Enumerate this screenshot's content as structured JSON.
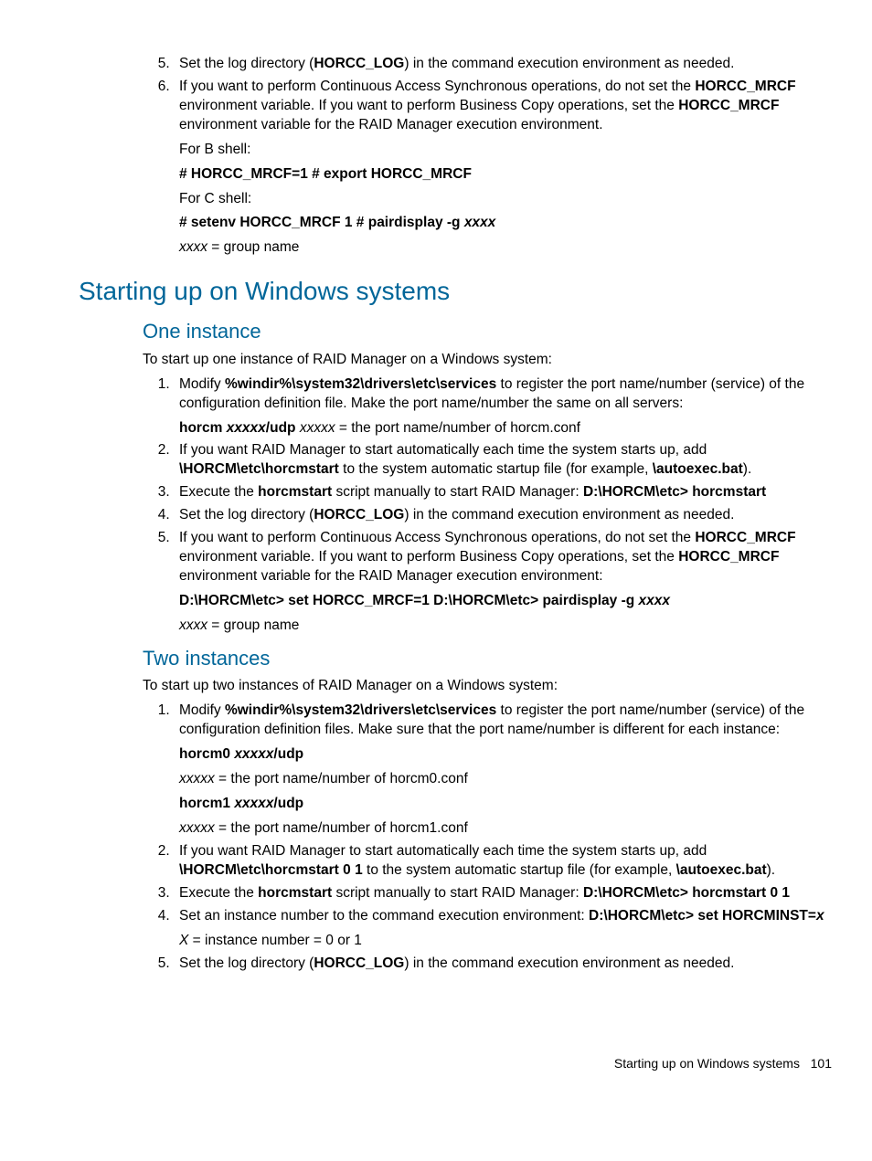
{
  "top_list": {
    "start": 5,
    "items": [
      {
        "pre": "Set the log directory (",
        "b1": "HORCC_LOG",
        "post": ") in the command execution environment as needed."
      },
      {
        "seg1": "If you want to perform Continuous Access Synchronous operations, do not set the ",
        "b1": "HORCC_MRCF",
        "seg2": " environment variable. If you want to perform Business Copy operations, set the ",
        "b2": "HORCC_MRCF",
        "seg3": " environment variable for the RAID Manager execution environment.",
        "sub1": "For B shell:",
        "sub2": "# HORCC_MRCF=1 # export HORCC_MRCF",
        "sub3": "For C shell:",
        "sub4_a": "# setenv HORCC_MRCF 1 # pairdisplay -g ",
        "sub4_b": "xxxx",
        "sub5_a": "xxxx",
        "sub5_b": " = group name"
      }
    ]
  },
  "h1": "Starting up on Windows systems",
  "sec1": {
    "title": "One instance",
    "intro": "To start up one instance of RAID Manager on a Windows system:",
    "items": [
      {
        "a": "Modify ",
        "b1": "%windir%\\system32\\drivers\\etc\\services",
        "c": " to register the port name/number (service) of the configuration definition file. Make the port name/number the same on all servers:",
        "sub_a": "horcm ",
        "sub_b": "xxxxx",
        "sub_c": "/udp",
        "sub_d": "   ",
        "sub_e": "xxxxx",
        "sub_f": " = the port name/number of horcm.conf"
      },
      {
        "a": "If you want RAID Manager to start automatically each time the system starts up, add ",
        "b1": "\\HORCM\\etc\\horcmstart",
        "c": " to the system automatic startup file (for example, ",
        "b2": "\\autoexec.bat",
        "d": ")."
      },
      {
        "a": "Execute the ",
        "b1": "horcmstart",
        "c": " script manually to start RAID Manager: ",
        "b2": "D:\\HORCM\\etc> horcmstart"
      },
      {
        "a": "Set the log directory (",
        "b1": "HORCC_LOG",
        "c": ") in the command execution environment as needed."
      },
      {
        "a": "If you want to perform Continuous Access Synchronous operations, do not set the ",
        "b1": "HORCC_MRCF",
        "c": " environment variable. If you want to perform Business Copy operations, set the ",
        "b2": "HORCC_MRCF",
        "d": " environment variable for the RAID Manager execution environment:",
        "sub_a": "D:\\HORCM\\etc> set HORCC_MRCF=1 D:\\HORCM\\etc> pairdisplay -g ",
        "sub_b": "xxxx",
        "sub2_a": "xxxx",
        "sub2_b": " = group name"
      }
    ]
  },
  "sec2": {
    "title": "Two instances",
    "intro": "To start up two instances of RAID Manager on a Windows system:",
    "items": [
      {
        "a": "Modify ",
        "b1": "%windir%\\system32\\drivers\\etc\\services",
        "c": " to register the port name/number (service) of the configuration definition files. Make sure that the port name/number is different for each instance:",
        "s1a": "horcm0 ",
        "s1b": "xxxxx",
        "s1c": "/udp",
        "s2a": "xxxxx",
        "s2b": " = the port name/number of horcm0.conf",
        "s3a": "horcm1 ",
        "s3b": "xxxxx",
        "s3c": "/udp",
        "s4a": "xxxxx",
        "s4b": " = the port name/number of horcm1.conf"
      },
      {
        "a": "If you want RAID Manager to start automatically each time the system starts up, add ",
        "b1": "\\HORCM\\etc\\horcmstart 0 1",
        "c": " to the system automatic startup file (for example, ",
        "b2": "\\autoexec.bat",
        "d": ")."
      },
      {
        "a": "Execute the ",
        "b1": "horcmstart",
        "c": " script manually to start RAID Manager: ",
        "b2": "D:\\HORCM\\etc> horcmstart 0 1"
      },
      {
        "a": "Set an instance number to the command execution environment:  ",
        "b1": "D:\\HORCM\\etc> set HORCMINST=",
        "b2": "x",
        "s1a": "X",
        "s1b": " = instance number = 0 or 1"
      },
      {
        "a": "Set the log directory (",
        "b1": "HORCC_LOG",
        "c": ") in the command execution environment as needed."
      }
    ]
  },
  "footer_label": "Starting up on Windows systems",
  "footer_page": "101"
}
